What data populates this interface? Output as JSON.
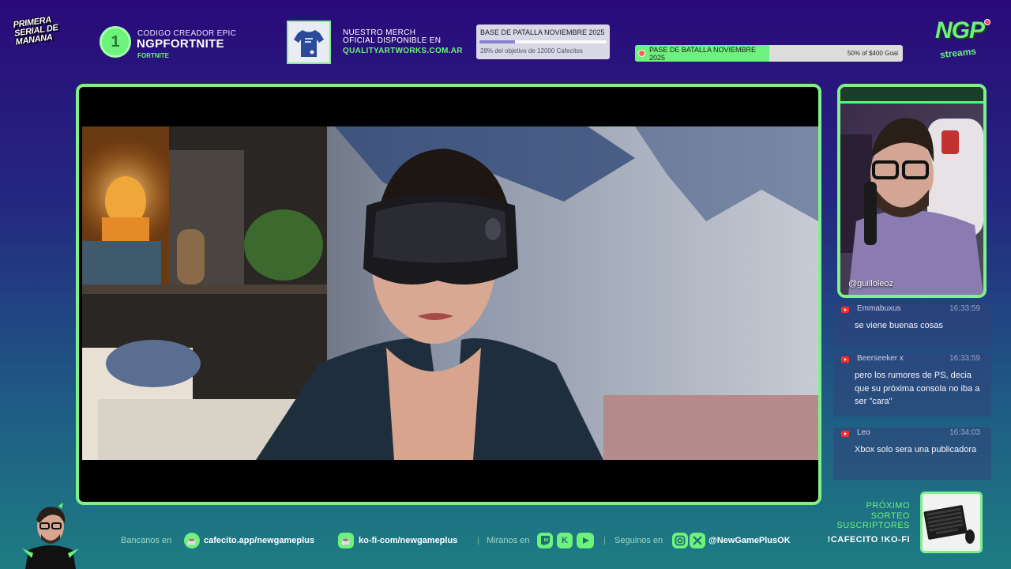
{
  "header": {
    "logo_left_text": "PRIMERA SERIAL DE MANANA",
    "creator": {
      "badge": "1",
      "label": "CODIGO CREADOR EPIC",
      "code": "NGPFORTNITE",
      "game": "FORTNITE"
    },
    "merch": {
      "line1": "NUESTRO MERCH",
      "line2": "OFICIAL DISPONIBLE EN",
      "url": "QUALITYARTWORKS.COM.AR"
    },
    "goal_cafecito": {
      "title": "BASE DE PATALLA NOVIEMBRE 2025",
      "progress_percent": 28,
      "subtitle": "28% del objetivo de 12000 Cafecitos"
    },
    "goal_kofi": {
      "title": "PASE DE BATALLA NOVIEMBRE 2025",
      "progress_percent": 50,
      "right_label": "50% of $400 Goal"
    },
    "logo_right": {
      "mark": "NGP",
      "sub": "streams"
    }
  },
  "webcam": {
    "handle": "@guilloleoz"
  },
  "chat": [
    {
      "user": "Emmabuxus",
      "time": "16:33:59",
      "text": "se viene buenas cosas"
    },
    {
      "user": "Beerseeker x",
      "time": "16:33:59",
      "text": "pero los rumores de PS, decia que su próxima consola no iba a ser \"cara\""
    },
    {
      "user": "Leo",
      "time": "16:34:03",
      "text": "Xbox solo sera una publicadora"
    }
  ],
  "footer": {
    "bancanos_label": "Bancanos en",
    "cafecito_link": "cafecito.app/newgameplus",
    "kofi_link": "ko-fi-com/newgameplus",
    "miranos_label": "Miranos en",
    "seguinos_label": "Seguinos en",
    "social_handle": "@NewGamePlusOK",
    "separator": "|"
  },
  "raffle": {
    "title_line1": "PRÓXIMO",
    "title_line2": "SORTEO",
    "title_line3": "SUSCRIPTORES",
    "commands": "!CAFECITO !KO-FI"
  },
  "colors": {
    "accent_green": "#6df27b",
    "frame_green": "#7ff08a",
    "bg_top": "#2a0a7a",
    "bg_bottom": "#1d7d83"
  }
}
